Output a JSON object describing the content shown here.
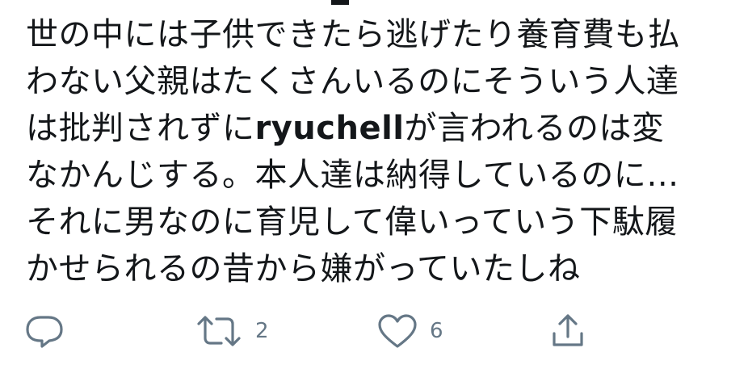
{
  "tweet": {
    "lines": [
      "世の中には子供できたら逃げたり養育費も払",
      "わない父親はたくさんいるのにそういう人達",
      "は批判されずに",
      "が言われるのは変",
      "なかんじする。本人達は納得しているのに…",
      "それに男なのに育児して偉いっていう下駄履",
      "かせられるの昔から嫌がっていたしね"
    ],
    "mention": "ryuchell"
  },
  "actions": {
    "reply": {
      "icon": "reply-icon",
      "count": ""
    },
    "retweet": {
      "icon": "retweet-icon",
      "count": "2"
    },
    "like": {
      "icon": "heart-icon",
      "count": "6"
    },
    "share": {
      "icon": "share-icon"
    }
  },
  "colors": {
    "text": "#14171a",
    "icon": "#657786"
  }
}
